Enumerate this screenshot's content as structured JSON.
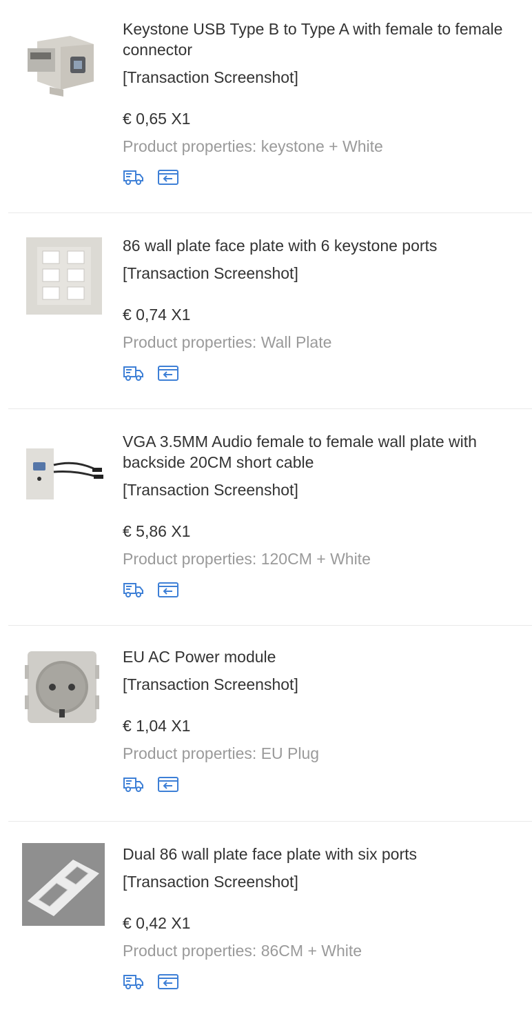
{
  "orders": [
    {
      "title": "Keystone USB Type B to Type A with female to female connector",
      "tag": "[Transaction Screenshot]",
      "price": "€ 0,65 X1",
      "properties": "Product properties: keystone + White",
      "thumb_icon": "usb-keystone-image"
    },
    {
      "title": "86 wall plate face plate with 6 keystone ports",
      "tag": "[Transaction Screenshot]",
      "price": "€ 0,74 X1",
      "properties": "Product properties: Wall Plate",
      "thumb_icon": "wall-plate-image"
    },
    {
      "title": "VGA 3.5MM Audio female to female wall plate with backside 20CM short cable",
      "tag": "[Transaction Screenshot]",
      "price": "€ 5,86 X1",
      "properties": "Product properties: 120CM + White",
      "thumb_icon": "vga-wall-plate-image"
    },
    {
      "title": "EU AC Power module",
      "tag": "[Transaction Screenshot]",
      "price": "€ 1,04 X1",
      "properties": "Product properties: EU Plug",
      "thumb_icon": "eu-power-module-image"
    },
    {
      "title": "Dual 86 wall plate face plate with six ports",
      "tag": "[Transaction Screenshot]",
      "price": "€ 0,42 X1",
      "properties": "Product properties: 86CM + White",
      "thumb_icon": "dual-wall-plate-image"
    }
  ],
  "icons": {
    "shipping": "truck-icon",
    "return": "return-icon"
  },
  "colors": {
    "accent": "#3d7fd6",
    "muted": "#9a9a9a",
    "text": "#333333",
    "divider": "#e9e9e9"
  }
}
